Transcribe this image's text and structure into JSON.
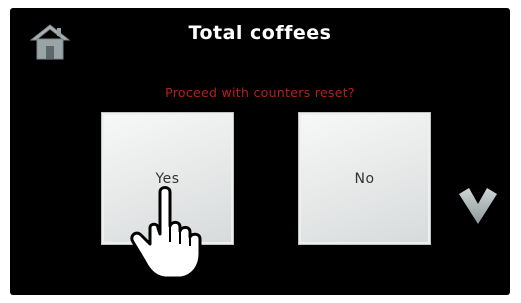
{
  "screen": {
    "title": "Total coffees",
    "prompt": "Proceed with counters reset?"
  },
  "buttons": {
    "yes_label": "Yes",
    "no_label": "No"
  },
  "icons": {
    "home": "home-icon",
    "scroll_down": "chevron-down-icon",
    "pointer": "pointing-hand-icon"
  },
  "colors": {
    "background": "#000000",
    "title": "#ffffff",
    "prompt": "#b3211c",
    "button_face": "#e8eaea",
    "icon_gray": "#9aa3a6"
  }
}
